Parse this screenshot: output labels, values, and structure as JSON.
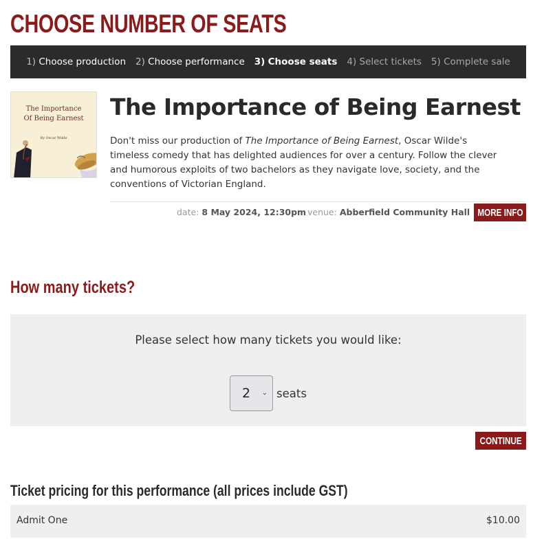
{
  "page": {
    "title": "CHOOSE NUMBER OF SEATS"
  },
  "steps": [
    {
      "num": "1)",
      "label": "Choose production",
      "state": "done"
    },
    {
      "num": "2)",
      "label": "Choose performance",
      "state": "done"
    },
    {
      "num": "3)",
      "label": "Choose seats",
      "state": "current"
    },
    {
      "num": "4)",
      "label": "Select tickets",
      "state": "future"
    },
    {
      "num": "5)",
      "label": "Complete sale",
      "state": "future"
    }
  ],
  "production": {
    "poster": {
      "title_line1": "The Importance",
      "title_line2": "Of Being Earnest",
      "author": "By Oscar Wilde"
    },
    "title": "The Importance of Being Earnest",
    "desc_pre": "Don't miss our production of ",
    "desc_em": "The Importance of Being Earnest",
    "desc_post": ", Oscar Wilde's timeless comedy that has delighted audiences for over a century. Follow the clever and humorous exploits of two bachelors as they navigate love, society, and the conventions of Victorian England.",
    "date_label": "date:",
    "date_value": "8 May 2024, 12:30pm",
    "venue_label": "venue:",
    "venue_value": "Abberfield Community Hall",
    "more_info": "MORE INFO"
  },
  "tickets": {
    "heading": "How many tickets?",
    "prompt": "Please select how many tickets you would like:",
    "selected": "2",
    "unit": "seats",
    "continue": "CONTINUE"
  },
  "pricing": {
    "heading": "Ticket pricing for this performance (all prices include GST)",
    "rows": [
      {
        "name": "Admit One",
        "price": "$10.00"
      }
    ]
  },
  "colors": {
    "accent": "#8b1a1a",
    "nav_bg": "#2b2b2b",
    "panel_bg": "#efefef"
  }
}
